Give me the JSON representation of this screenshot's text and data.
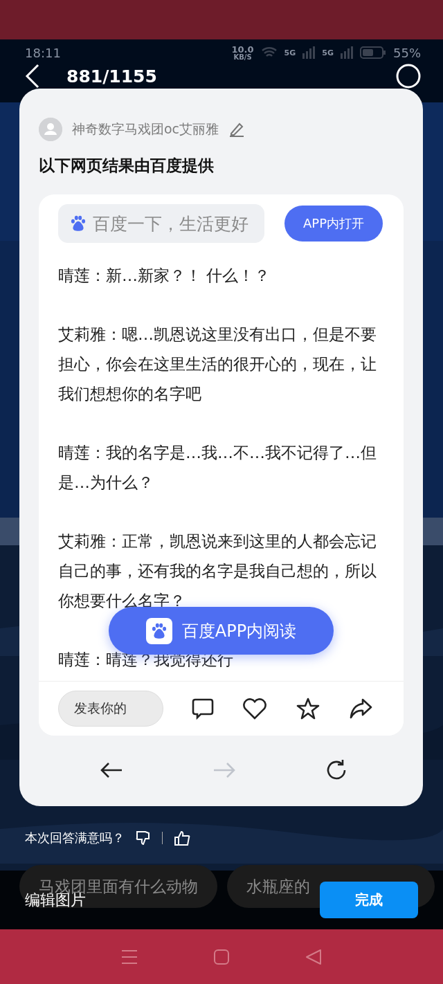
{
  "status_bar": {
    "time": "18:11",
    "speed": "10.0",
    "speed_unit": "KB/S",
    "network_1": "5G",
    "network_2": "5G",
    "battery": "55%"
  },
  "header": {
    "counter": "881/1155"
  },
  "card": {
    "author": "神奇数字马戏团oc艾丽雅",
    "heading": "以下网页结果由百度提供",
    "search": {
      "placeholder": "百度一下，生活更好"
    },
    "open_button": "APP内打开",
    "paragraphs": [
      "晴莲：新…新家？！ 什么！？",
      "艾莉雅：嗯…凯恩说这里没有出口，但是不要担心，你会在这里生活的很开心的，现在，让我们想想你的名字吧",
      "晴莲：我的名字是…我…不…我不记得了…但是…为什么？",
      "艾莉雅：正常，凯恩说来到这里的人都会忘记自己的事，还有我的名字是我自己想的，所以你想要什么名字？",
      "晴莲：晴莲？我觉得还行"
    ],
    "read_button": "百度APP内阅读",
    "comment_placeholder": "发表你的",
    "nav": {
      "back_disabled": false,
      "forward_disabled": true
    }
  },
  "feedback": {
    "question": "本次回答满意吗？"
  },
  "suggestions": [
    "马戏团里面有什么动物",
    "水瓶座的"
  ],
  "edit_bar": {
    "label": "编辑图片",
    "done": "完成"
  }
}
